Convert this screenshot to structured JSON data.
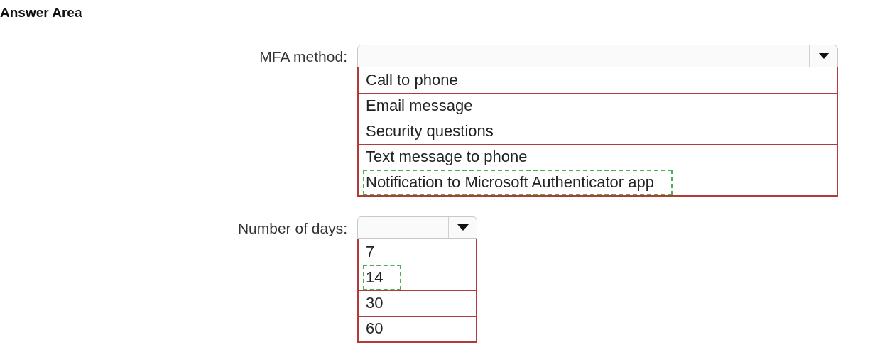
{
  "title": "Answer Area",
  "questions": [
    {
      "label": "MFA method:",
      "options": [
        {
          "text": "Call to phone",
          "selected": false
        },
        {
          "text": "Email message",
          "selected": false
        },
        {
          "text": "Security questions",
          "selected": false
        },
        {
          "text": "Text message to phone",
          "selected": false
        },
        {
          "text": "Notification to Microsoft Authenticator app",
          "selected": true
        }
      ]
    },
    {
      "label": "Number of days:",
      "options": [
        {
          "text": "7",
          "selected": false
        },
        {
          "text": "14",
          "selected": true
        },
        {
          "text": "30",
          "selected": false
        },
        {
          "text": "60",
          "selected": false
        }
      ]
    }
  ]
}
